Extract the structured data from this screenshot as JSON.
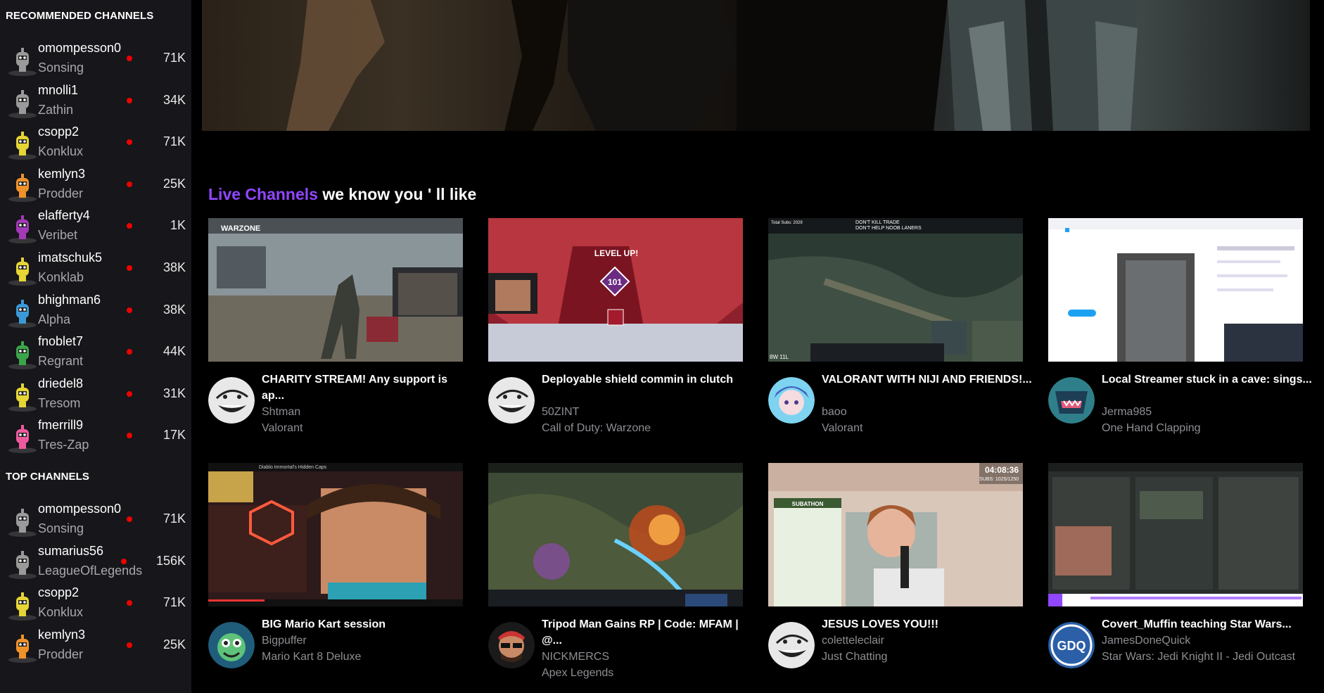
{
  "sidebar": {
    "recommended_title": "RECOMMENDED CHANNELS",
    "top_title": "TOP CHANNELS",
    "recommended": [
      {
        "name": "omompesson0",
        "game": "Sonsing",
        "views": "71K",
        "avatar": "gray-robot-icon"
      },
      {
        "name": "mnolli1",
        "game": "Zathin",
        "views": "34K",
        "avatar": "gray-robot-icon"
      },
      {
        "name": "csopp2",
        "game": "Konklux",
        "views": "71K",
        "avatar": "yellow-robot-icon"
      },
      {
        "name": "kemlyn3",
        "game": "Prodder",
        "views": "25K",
        "avatar": "orange-robot-icon"
      },
      {
        "name": "elafferty4",
        "game": "Veribet",
        "views": "1K",
        "avatar": "purple-robot-icon"
      },
      {
        "name": "imatschuk5",
        "game": "Konklab",
        "views": "38K",
        "avatar": "yellow-robot-icon"
      },
      {
        "name": "bhighman6",
        "game": "Alpha",
        "views": "38K",
        "avatar": "blue-robot-icon"
      },
      {
        "name": "fnoblet7",
        "game": "Regrant",
        "views": "44K",
        "avatar": "green-robot-icon"
      },
      {
        "name": "driedel8",
        "game": "Tresom",
        "views": "31K",
        "avatar": "yellow-robot-icon"
      },
      {
        "name": "fmerrill9",
        "game": "Tres-Zap",
        "views": "17K",
        "avatar": "pink-robot-icon"
      }
    ],
    "top": [
      {
        "name": "omompesson0",
        "game": "Sonsing",
        "views": "71K",
        "avatar": "gray-robot-icon"
      },
      {
        "name": "sumarius56",
        "game": "LeagueOfLegends",
        "views": "156K",
        "avatar": "gray-robot-icon"
      },
      {
        "name": "csopp2",
        "game": "Konklux",
        "views": "71K",
        "avatar": "yellow-robot-icon"
      },
      {
        "name": "kemlyn3",
        "game": "Prodder",
        "views": "25K",
        "avatar": "orange-robot-icon"
      }
    ]
  },
  "main": {
    "heading_accent": "Live Channels",
    "heading_rest": " we know you ' ll like",
    "cards": [
      {
        "title": "CHARITY STREAM! Any support is ap...",
        "streamer": "Shtman",
        "game": "Valorant",
        "thumb": "warzone-gameplay",
        "avatar": "trollface-icon"
      },
      {
        "title": "Deployable shield commin in clutch",
        "streamer": "50ZINT",
        "game": "Call of Duty: Warzone",
        "thumb": "apex-level-up",
        "avatar": "trollface-icon"
      },
      {
        "title": "VALORANT WITH NIJI AND FRIENDS!...",
        "streamer": "baoo",
        "game": "Valorant",
        "thumb": "league-gameplay",
        "avatar": "anime-avatar-icon"
      },
      {
        "title": "Local Streamer stuck in a cave: sings...",
        "streamer": "Jerma985",
        "game": "One Hand Clapping",
        "thumb": "twitter-page",
        "avatar": "monster-avatar-icon"
      },
      {
        "title": "BIG Mario Kart session",
        "streamer": "Bigpuffer",
        "game": "Mario Kart 8 Deluxe",
        "thumb": "video-player",
        "avatar": "green-monster-avatar-icon"
      },
      {
        "title": "Tripod Man Gains RP | Code: MFAM | @...",
        "streamer": "NICKMERCS",
        "game": "Apex Legends",
        "thumb": "dota-gameplay",
        "avatar": "sunglasses-avatar-icon"
      },
      {
        "title": "JESUS LOVES YOU!!!",
        "streamer": "coletteleclair",
        "game": "Just Chatting",
        "thumb": "webcam-chat",
        "avatar": "trollface-icon"
      },
      {
        "title": "Covert_Muffin teaching Star Wars...",
        "streamer": "JamesDoneQuick",
        "game": "Star Wars: Jedi Knight II - Jedi Outcast",
        "thumb": "inventory-screen",
        "avatar": "gdq-logo-icon"
      }
    ],
    "thumb_text": {
      "warzone": "WARZONE",
      "level_up": "LEVEL UP!",
      "level_num": "101",
      "league_top": "DON'T KILL TRADE",
      "league_top2": "DON'T HELP NOOB LANERS",
      "league_subs": "Total Subs: 2029",
      "league_score": "8W 11L",
      "video_title": "Diablo Immortal's Hidden Caps",
      "timer": "04:08:36",
      "subs": "SUBS: 1025/1250",
      "subathon": "SUBATHON"
    }
  },
  "colors": {
    "accent": "#9146ff",
    "live_dot": "#eb0400",
    "sidebar_bg": "#17161a"
  }
}
